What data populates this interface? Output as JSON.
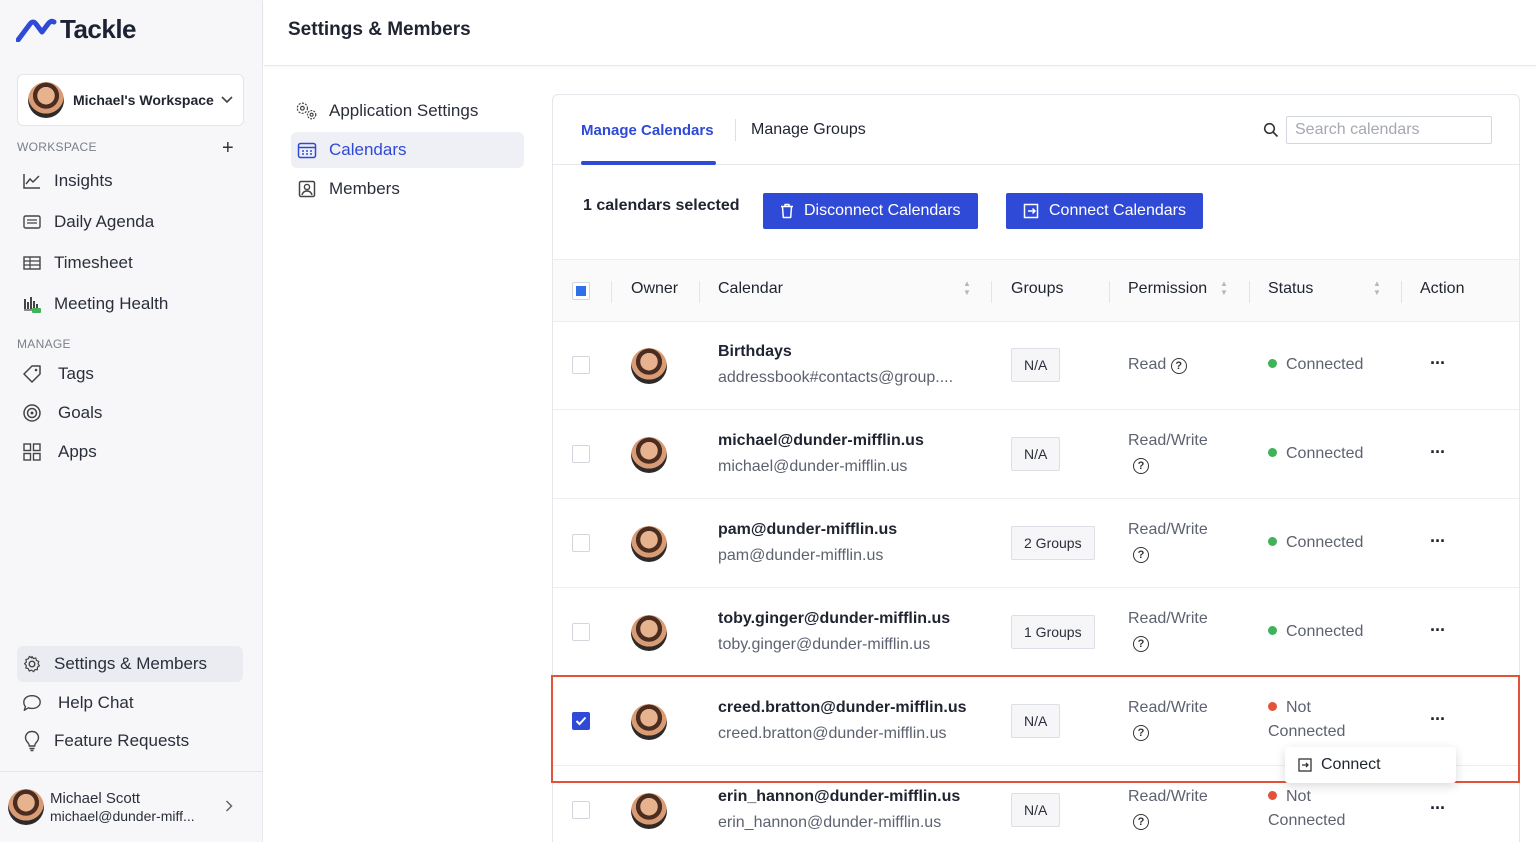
{
  "app": {
    "name": "Tackle"
  },
  "sidebar": {
    "workspace_name": "Michael's Workspace",
    "workspace_label": "WORKSPACE",
    "manage_label": "MANAGE",
    "workspace_items": [
      {
        "label": "Insights",
        "icon": "line-chart-icon"
      },
      {
        "label": "Daily Agenda",
        "icon": "agenda-icon"
      },
      {
        "label": "Timesheet",
        "icon": "table-icon"
      },
      {
        "label": "Meeting Health",
        "icon": "bar-chart-icon"
      }
    ],
    "manage_items": [
      {
        "label": "Tags",
        "icon": "tag-icon"
      },
      {
        "label": "Goals",
        "icon": "target-icon"
      },
      {
        "label": "Apps",
        "icon": "apps-grid-icon"
      }
    ],
    "bottom_items": [
      {
        "label": "Settings & Members",
        "icon": "gear-icon",
        "active": true
      },
      {
        "label": "Help Chat",
        "icon": "chat-bubble-icon"
      },
      {
        "label": "Feature Requests",
        "icon": "lightbulb-icon"
      }
    ],
    "profile": {
      "name": "Michael Scott",
      "email": "michael@dunder-miff..."
    }
  },
  "header": {
    "title": "Settings & Members"
  },
  "settings_nav": [
    {
      "label": "Application Settings",
      "icon": "gears-icon"
    },
    {
      "label": "Calendars",
      "icon": "calendar-icon",
      "active": true
    },
    {
      "label": "Members",
      "icon": "member-icon"
    }
  ],
  "tabs": [
    {
      "label": "Manage Calendars",
      "active": true
    },
    {
      "label": "Manage Groups"
    }
  ],
  "search": {
    "placeholder": "Search calendars"
  },
  "toolbar": {
    "selected_text": "1 calendars selected",
    "disconnect_label": "Disconnect Calendars",
    "connect_label": "Connect Calendars"
  },
  "table": {
    "columns": [
      "Owner",
      "Calendar",
      "Groups",
      "Permission",
      "Status",
      "Action"
    ],
    "rows": [
      {
        "name": "Birthdays",
        "sub": "addressbook#contacts@group....",
        "groups": "N/A",
        "permission": "Read",
        "status": "Connected",
        "status_color": "#3fb25a",
        "checked": false
      },
      {
        "name": "michael@dunder-mifflin.us",
        "sub": "michael@dunder-mifflin.us",
        "groups": "N/A",
        "permission": "Read/Write",
        "status": "Connected",
        "status_color": "#3fb25a",
        "checked": false
      },
      {
        "name": "pam@dunder-mifflin.us",
        "sub": "pam@dunder-mifflin.us",
        "groups": "2 Groups",
        "permission": "Read/Write",
        "status": "Connected",
        "status_color": "#3fb25a",
        "checked": false
      },
      {
        "name": "toby.ginger@dunder-mifflin.us",
        "sub": "toby.ginger@dunder-mifflin.us",
        "groups": "1 Groups",
        "permission": "Read/Write",
        "status": "Connected",
        "status_color": "#3fb25a",
        "checked": false
      },
      {
        "name": "creed.bratton@dunder-mifflin.us",
        "sub": "creed.bratton@dunder-mifflin.us",
        "groups": "N/A",
        "permission": "Read/Write",
        "status_line1": "Not",
        "status_line2": "Connected",
        "status_color": "#e2533a",
        "checked": true
      },
      {
        "name": "erin_hannon@dunder-mifflin.us",
        "sub": "erin_hannon@dunder-mifflin.us",
        "groups": "N/A",
        "permission": "Read/Write",
        "status_line1": "Not",
        "status_line2": "Connected",
        "status_color": "#e2533a",
        "checked": false
      }
    ]
  },
  "popover": {
    "label": "Connect"
  },
  "colors": {
    "accent": "#2f4ad6",
    "connected": "#3fb25a",
    "not_connected": "#e2533a",
    "highlight": "#e2533a"
  }
}
